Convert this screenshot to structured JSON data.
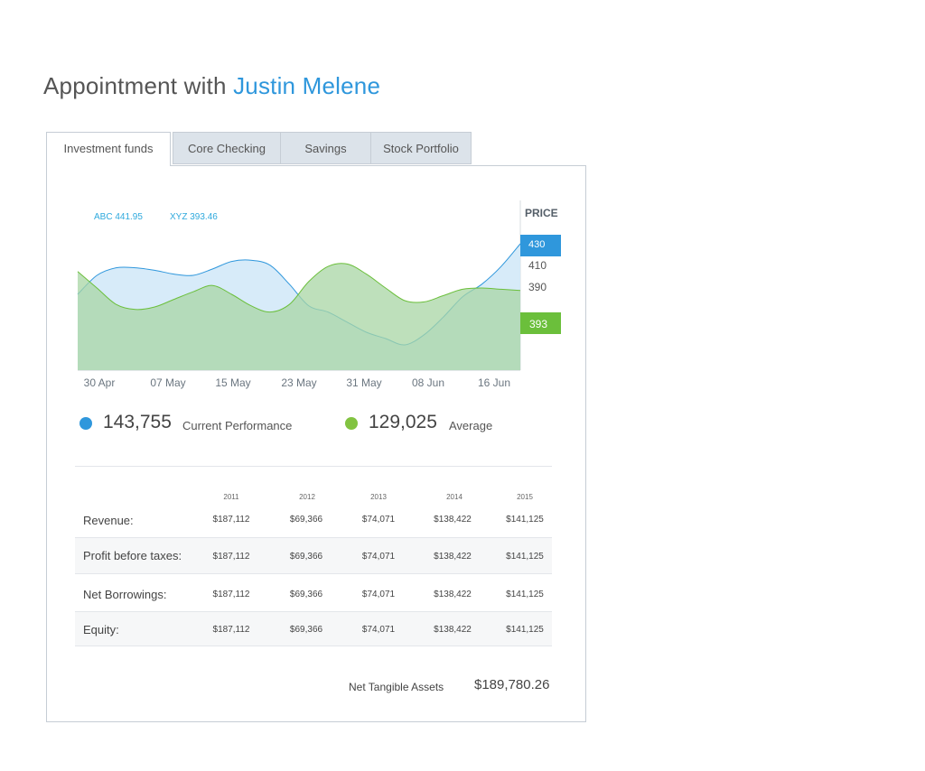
{
  "page": {
    "title_prefix": "Appointment with",
    "title_name": "Justin Melene",
    "accent_color": "#2f97dc"
  },
  "tabs": [
    {
      "label": "Investment funds",
      "active": true
    },
    {
      "label": "Core Checking",
      "active": false
    },
    {
      "label": "Savings",
      "active": false
    },
    {
      "label": "Stock Portfolio",
      "active": false
    }
  ],
  "chart_data": {
    "type": "area",
    "x_labels": [
      "30 Apr",
      "07 May",
      "15 May",
      "23 May",
      "31 May",
      "08 Jun",
      "16 Jun"
    ],
    "price_label": "PRICE",
    "price_ticks": [
      "430",
      "410",
      "390"
    ],
    "ticker_labels": [
      {
        "name": "ABC",
        "value": "441.95"
      },
      {
        "name": "XYZ",
        "value": "393.46"
      }
    ],
    "highlight_blue": "430",
    "highlight_green": "393",
    "series": [
      {
        "name": "ABC",
        "color": "#2f97dc",
        "fill": "#d3e9f8",
        "values": [
          390,
          405,
          411,
          411,
          409,
          406,
          405,
          410,
          416,
          417,
          413,
          398,
          381,
          376,
          368,
          360,
          355,
          350,
          358,
          372,
          388,
          398,
          412,
          430
        ]
      },
      {
        "name": "XYZ",
        "color": "#6bbf3b",
        "fill": "#a8d6a4",
        "values": [
          408,
          395,
          382,
          378,
          380,
          386,
          392,
          397,
          390,
          381,
          376,
          382,
          400,
          412,
          414,
          406,
          395,
          385,
          384,
          389,
          394,
          395,
          394,
          393
        ]
      }
    ],
    "ylim": [
      330,
      430
    ]
  },
  "legend": [
    {
      "value": "143,755",
      "label": "Current Performance",
      "color": "#2f97dc"
    },
    {
      "value": "129,025",
      "label": "Average",
      "color": "#82c341"
    }
  ],
  "table": {
    "years": [
      "2011",
      "2012",
      "2013",
      "2014",
      "2015"
    ],
    "rows": [
      {
        "label": "Revenue:",
        "values": [
          "$187,112",
          "$69,366",
          "$74,071",
          "$138,422",
          "$141,125"
        ]
      },
      {
        "label": "Profit before taxes:",
        "values": [
          "$187,112",
          "$69,366",
          "$74,071",
          "$138,422",
          "$141,125"
        ]
      },
      {
        "label": "Net Borrowings:",
        "values": [
          "$187,112",
          "$69,366",
          "$74,071",
          "$138,422",
          "$141,125"
        ]
      },
      {
        "label": "Equity:",
        "values": [
          "$187,112",
          "$69,366",
          "$74,071",
          "$138,422",
          "$141,125"
        ]
      }
    ]
  },
  "summary": {
    "label": "Net Tangible Assets",
    "value": "$189,780.26"
  }
}
